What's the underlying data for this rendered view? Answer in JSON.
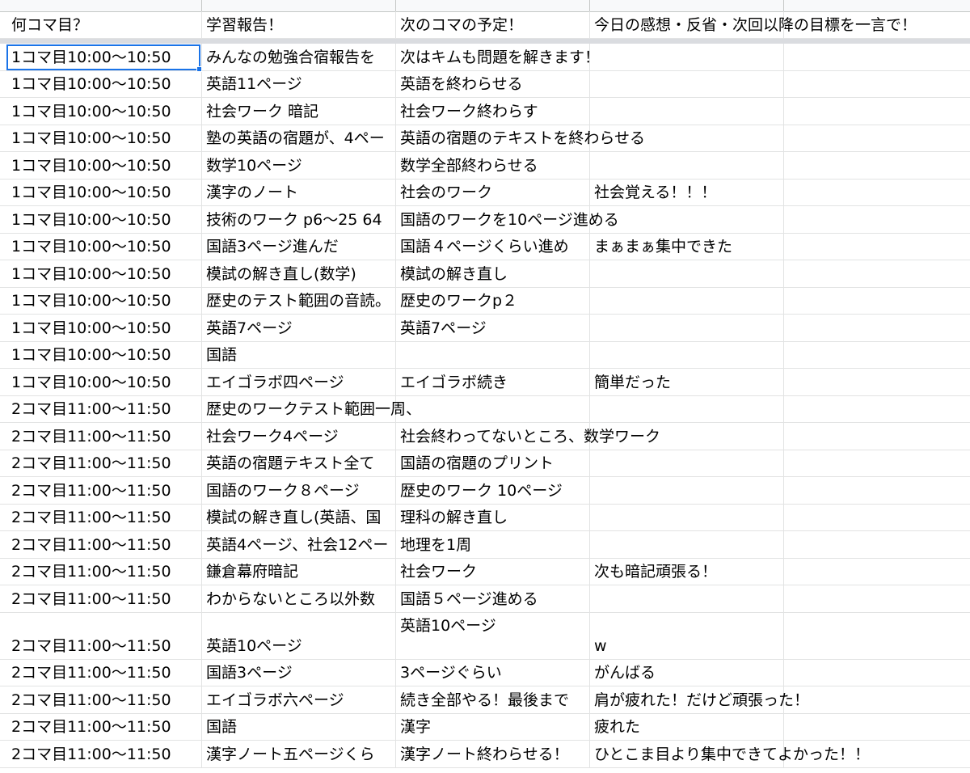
{
  "header": [
    "何コマ目？",
    "学習報告！",
    "次のコマの予定！",
    "今日の感想・反省・次回以降の目標を一言で！"
  ],
  "rows": [
    [
      "1コマ目10:00〜10:50",
      "みんなの勉強合宿報告を",
      "次はキムも問題を解きます！",
      ""
    ],
    [
      "1コマ目10:00〜10:50",
      "英語11ページ",
      "英語を終わらせる",
      ""
    ],
    [
      "1コマ目10:00〜10:50",
      "社会ワーク  暗記",
      "社会ワーク終わらす",
      ""
    ],
    [
      "1コマ目10:00〜10:50",
      "塾の英語の宿題が、4ペー",
      "英語の宿題のテキストを終わらせる",
      ""
    ],
    [
      "1コマ目10:00〜10:50",
      "数学10ページ",
      "数学全部終わらせる",
      ""
    ],
    [
      "1コマ目10:00〜10:50",
      "漢字のノート",
      "社会のワーク",
      "社会覚える！！！"
    ],
    [
      "1コマ目10:00〜10:50",
      "技術のワーク p6〜25 64",
      "国語のワークを10ページ進める",
      ""
    ],
    [
      "1コマ目10:00〜10:50",
      "国語3ページ進んだ",
      "国語４ページくらい進め",
      "まぁまぁ集中できた"
    ],
    [
      "1コマ目10:00〜10:50",
      "模試の解き直し(数学)",
      "模試の解き直し",
      ""
    ],
    [
      "1コマ目10:00〜10:50",
      "歴史のテスト範囲の音読。",
      "歴史のワークp２",
      ""
    ],
    [
      "1コマ目10:00〜10:50",
      "英語7ページ",
      "英語7ページ",
      ""
    ],
    [
      "1コマ目10:00〜10:50",
      "国語",
      "",
      ""
    ],
    [
      "1コマ目10:00〜10:50",
      "エイゴラボ四ページ",
      "エイゴラボ続き",
      "簡単だった"
    ],
    [
      "2コマ目11:00〜11:50",
      "歴史のワークテスト範囲一周、",
      "",
      ""
    ],
    [
      "2コマ目11:00〜11:50",
      "社会ワーク4ページ",
      "社会終わってないところ、数学ワーク",
      ""
    ],
    [
      "2コマ目11:00〜11:50",
      "英語の宿題テキスト全て",
      "国語の宿題のプリント",
      ""
    ],
    [
      "2コマ目11:00〜11:50",
      "国語のワーク８ページ",
      "歴史のワーク 10ページ",
      ""
    ],
    [
      "2コマ目11:00〜11:50",
      "模試の解き直し(英語、国",
      "理科の解き直し",
      ""
    ],
    [
      "2コマ目11:00〜11:50",
      "英語4ページ、社会12ペー",
      "地理を1周",
      ""
    ],
    [
      "2コマ目11:00〜11:50",
      "鎌倉幕府暗記",
      "社会ワーク",
      "次も暗記頑張る！"
    ],
    [
      "2コマ目11:00〜11:50",
      "わからないところ以外数",
      "国語５ページ進める",
      ""
    ],
    [
      "2コマ目11:00〜11:50",
      "英語10ページ",
      "英語10ページ",
      "w"
    ],
    [
      "2コマ目11:00〜11:50",
      "国語3ページ",
      "3ページぐらい",
      "がんばる"
    ],
    [
      "2コマ目11:00〜11:50",
      "エイゴラボ六ページ",
      "続き全部やる！最後まで",
      "肩が疲れた！だけど頑張った！"
    ],
    [
      "2コマ目11:00〜11:50",
      "国語",
      "漢字",
      "疲れた"
    ],
    [
      "2コマ目11:00〜11:50",
      "漢字ノート五ページくら",
      "漢字ノート終わらせる！",
      "ひとこま目より集中できてよかった！！"
    ]
  ],
  "colors": {
    "selection": "#1a73e8",
    "gridline": "#e2e3e3",
    "freeze_bar": "#dadce0"
  }
}
